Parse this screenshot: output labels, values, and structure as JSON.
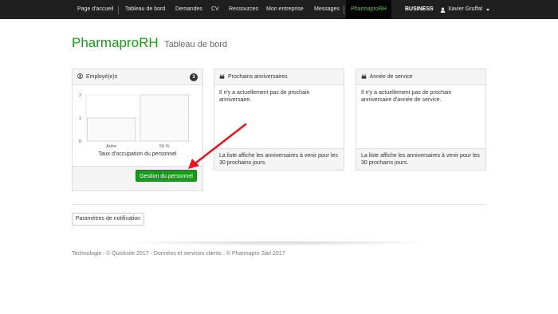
{
  "navbar": {
    "items": [
      {
        "label": "Page d'accueil"
      },
      {
        "label": "Tableau de bord"
      },
      {
        "label": "Demandes"
      },
      {
        "label": "CV"
      },
      {
        "label": "Ressources"
      },
      {
        "label": "Mon entreprise"
      },
      {
        "label": "Messages"
      },
      {
        "label": "PharmaproRH"
      }
    ],
    "business_label": "BUSINESS",
    "user_name": "Xavier Gruffat",
    "active_color": "#5cc45c"
  },
  "header": {
    "brand": "PharmaproRH",
    "subtitle": "Tableau de bord",
    "brand_color": "#1a9a1a"
  },
  "employees_panel": {
    "title": "Employé(e)s",
    "icon": "user-circle-icon",
    "badge": "3",
    "chart_caption": "Taux d'occupation du personnel",
    "button_label": "Gestion du personnel"
  },
  "chart_data": {
    "type": "bar",
    "categories": [
      "Autre",
      "50 %"
    ],
    "values": [
      1,
      2
    ],
    "title": "Taux d'occupation du personnel",
    "xlabel": "",
    "ylabel": "",
    "ylim": [
      0,
      2
    ],
    "yticks": [
      "0",
      "1",
      "2"
    ],
    "grid": true
  },
  "birthdays_panel": {
    "title": "Prochains anniversaires",
    "icon": "cake-icon",
    "body": "Il n'y a actuellement pas de prochain anniversaire.",
    "footer": "La liste affiche les anniversaires à venir pour les 30 prochains jours."
  },
  "service_panel": {
    "title": "Année de service",
    "icon": "cake-icon",
    "body": "Il n'y a actuellement pas de prochain anniversaire d'année de service.",
    "footer": "La liste affiche les anniversaires à venir pour les 30 prochains jours."
  },
  "notification_button": "Paramètres de notification",
  "footer": "Technologie : © Quicksite 2017 - Données et services clients : © Pharmapro Sàrl 2017",
  "annotation_color": "#e8141c"
}
